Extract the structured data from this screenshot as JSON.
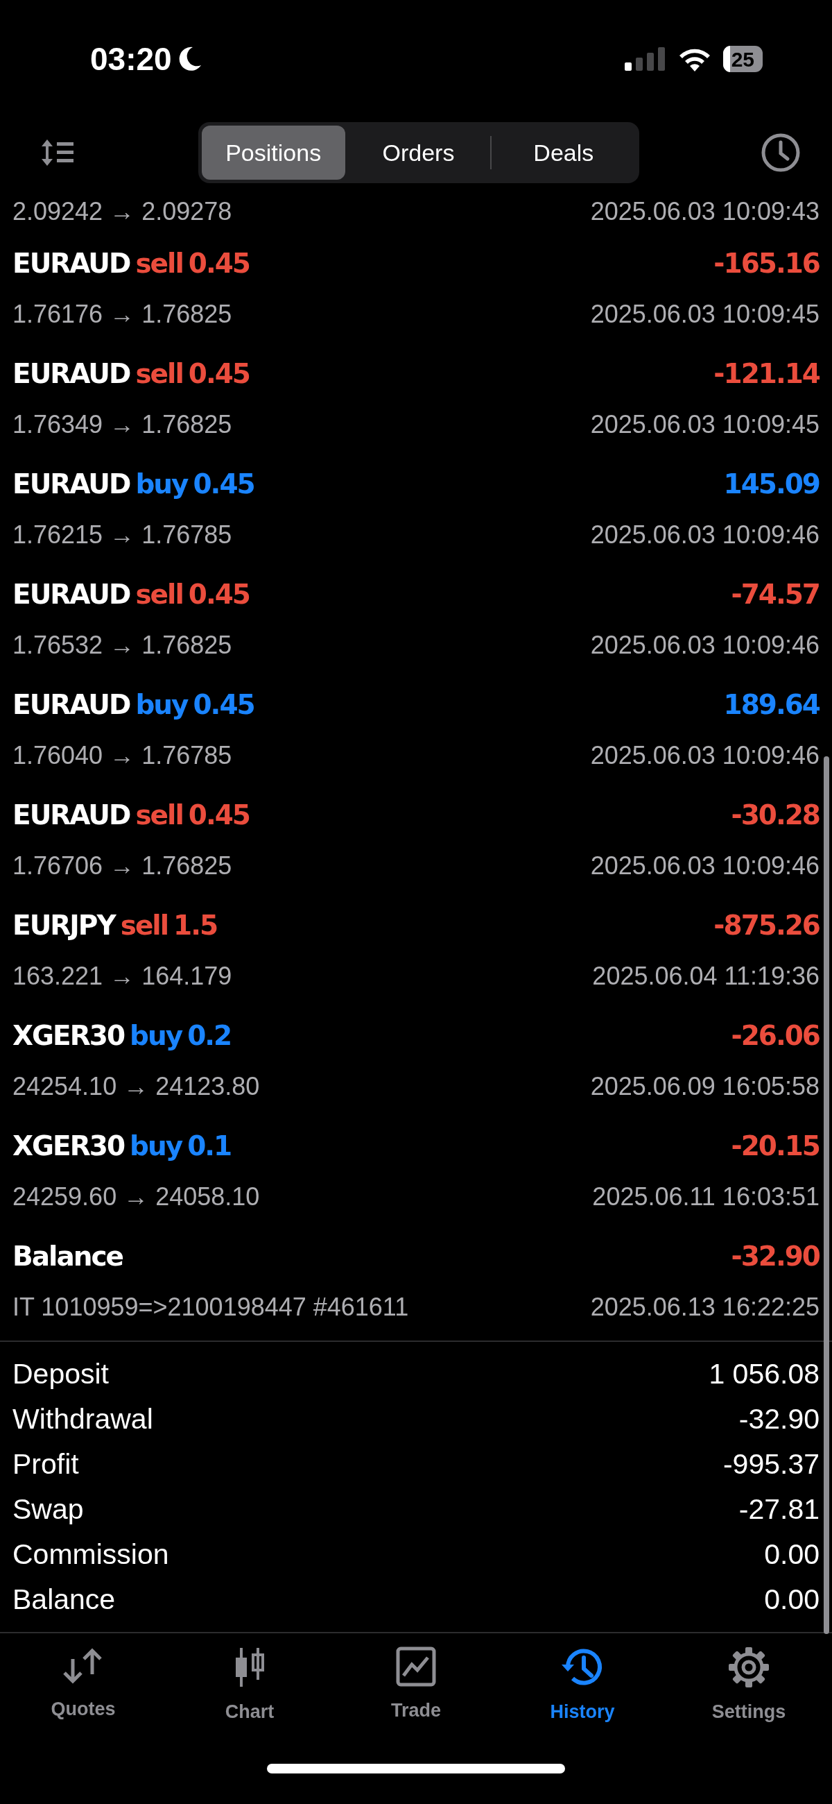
{
  "status_bar": {
    "time": "03:20",
    "battery": "25"
  },
  "segments": [
    {
      "label": "Positions",
      "selected": true
    },
    {
      "label": "Orders",
      "selected": false
    },
    {
      "label": "Deals",
      "selected": false
    }
  ],
  "partial_row": {
    "prices": "2.09242 → 2.09278",
    "time": "2025.06.03 10:09:43"
  },
  "deals": [
    {
      "kind": "trade",
      "symbol": "EURAUD",
      "side": "sell",
      "volume": "0.45",
      "profit": "-165.16",
      "loss": true,
      "prices": "1.76176 → 1.76825",
      "time": "2025.06.03 10:09:45"
    },
    {
      "kind": "trade",
      "symbol": "EURAUD",
      "side": "sell",
      "volume": "0.45",
      "profit": "-121.14",
      "loss": true,
      "prices": "1.76349 → 1.76825",
      "time": "2025.06.03 10:09:45"
    },
    {
      "kind": "trade",
      "symbol": "EURAUD",
      "side": "buy",
      "volume": "0.45",
      "profit": "145.09",
      "loss": false,
      "prices": "1.76215 → 1.76785",
      "time": "2025.06.03 10:09:46"
    },
    {
      "kind": "trade",
      "symbol": "EURAUD",
      "side": "sell",
      "volume": "0.45",
      "profit": "-74.57",
      "loss": true,
      "prices": "1.76532 → 1.76825",
      "time": "2025.06.03 10:09:46"
    },
    {
      "kind": "trade",
      "symbol": "EURAUD",
      "side": "buy",
      "volume": "0.45",
      "profit": "189.64",
      "loss": false,
      "prices": "1.76040 → 1.76785",
      "time": "2025.06.03 10:09:46"
    },
    {
      "kind": "trade",
      "symbol": "EURAUD",
      "side": "sell",
      "volume": "0.45",
      "profit": "-30.28",
      "loss": true,
      "prices": "1.76706 → 1.76825",
      "time": "2025.06.03 10:09:46"
    },
    {
      "kind": "trade",
      "symbol": "EURJPY",
      "side": "sell",
      "volume": "1.5",
      "profit": "-875.26",
      "loss": true,
      "prices": "163.221 → 164.179",
      "time": "2025.06.04 11:19:36"
    },
    {
      "kind": "trade",
      "symbol": "XGER30",
      "side": "buy",
      "volume": "0.2",
      "profit": "-26.06",
      "loss": true,
      "prices": "24254.10 → 24123.80",
      "time": "2025.06.09 16:05:58"
    },
    {
      "kind": "trade",
      "symbol": "XGER30",
      "side": "buy",
      "volume": "0.1",
      "profit": "-20.15",
      "loss": true,
      "prices": "24259.60 → 24058.10",
      "time": "2025.06.11 16:03:51"
    },
    {
      "kind": "balance",
      "symbol": "Balance",
      "profit": "-32.90",
      "loss": true,
      "prices": "IT 1010959=>2100198447 #461611",
      "time": "2025.06.13 16:22:25"
    }
  ],
  "summary": [
    {
      "label": "Deposit",
      "value": "1 056.08"
    },
    {
      "label": "Withdrawal",
      "value": "-32.90"
    },
    {
      "label": "Profit",
      "value": "-995.37"
    },
    {
      "label": "Swap",
      "value": "-27.81"
    },
    {
      "label": "Commission",
      "value": "0.00"
    },
    {
      "label": "Balance",
      "value": "0.00"
    }
  ],
  "tab_bar": [
    {
      "kind": "quotes",
      "label": "Quotes",
      "selected": false
    },
    {
      "kind": "chart",
      "label": "Chart",
      "selected": false
    },
    {
      "kind": "trade",
      "label": "Trade",
      "selected": false
    },
    {
      "kind": "history",
      "label": "History",
      "selected": true
    },
    {
      "kind": "settings",
      "label": "Settings",
      "selected": false
    }
  ]
}
